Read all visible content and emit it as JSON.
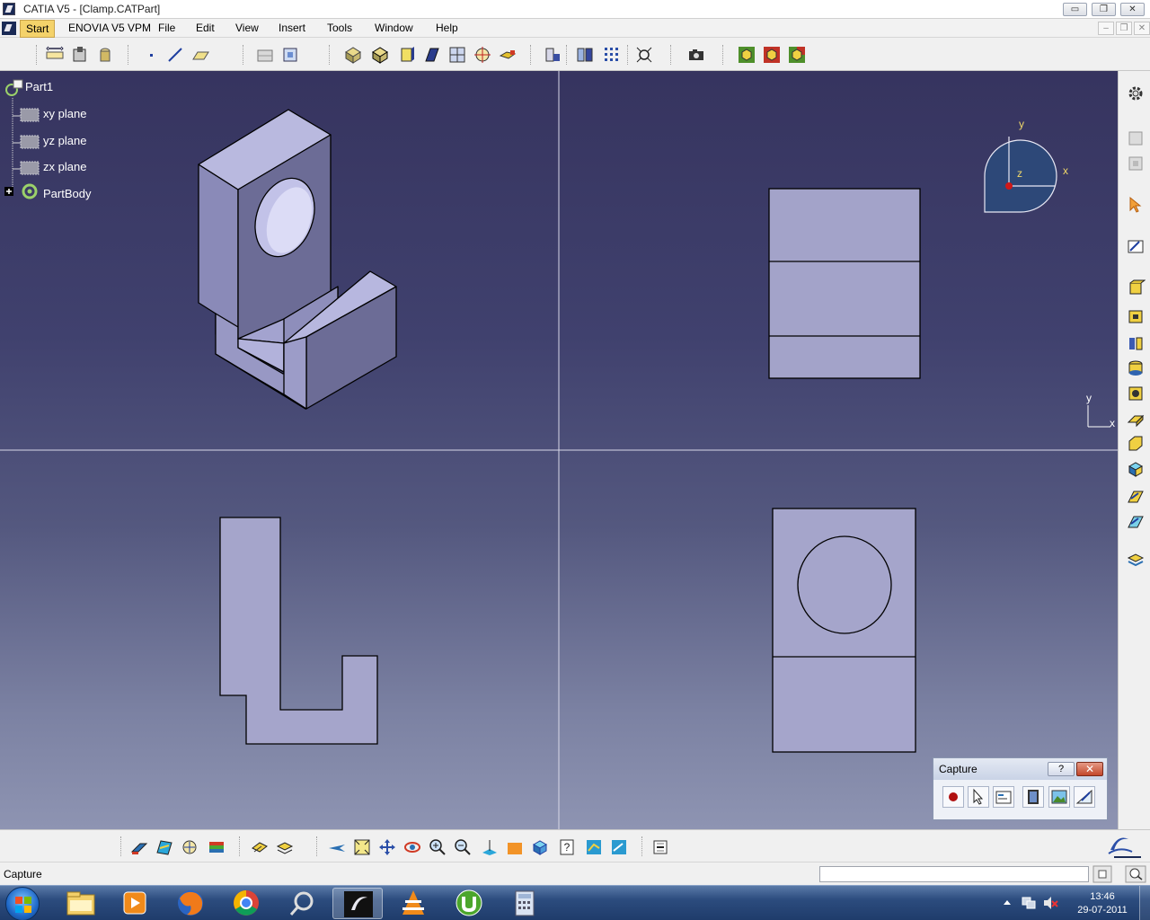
{
  "window": {
    "title": "CATIA V5 - [Clamp.CATPart]",
    "minimize_glyph": "▭",
    "restore_glyph": "❐",
    "close_glyph": "✕"
  },
  "menu": {
    "start": "Start",
    "items": [
      "ENOVIA V5 VPM",
      "File",
      "Edit",
      "View",
      "Insert",
      "Tools",
      "Window",
      "Help"
    ],
    "doc_min_glyph": "–",
    "doc_restore_glyph": "❐",
    "doc_close_glyph": "✕"
  },
  "tree": {
    "root": "Part1",
    "children": [
      "xy plane",
      "yz plane",
      "zx plane"
    ],
    "body": "PartBody"
  },
  "compass": {
    "y": "y",
    "x": "x",
    "z": "z"
  },
  "viewport_axes": {
    "y": "y",
    "x": "x"
  },
  "capture_toolbar": {
    "title": "Capture",
    "help_glyph": "?",
    "close_glyph": "✕"
  },
  "status": {
    "text": "Capture",
    "power_input_value": ""
  },
  "taskbar": {
    "time": "13:46",
    "date": "29-07-2011"
  },
  "colors": {
    "viewport_top": "#36345f",
    "viewport_bottom": "#8e94b2",
    "part_face": "#a9a9d3",
    "part_dark": "#6e6e98",
    "part_mid": "#8c8cbc",
    "start_highlight": "#f4d26a"
  }
}
